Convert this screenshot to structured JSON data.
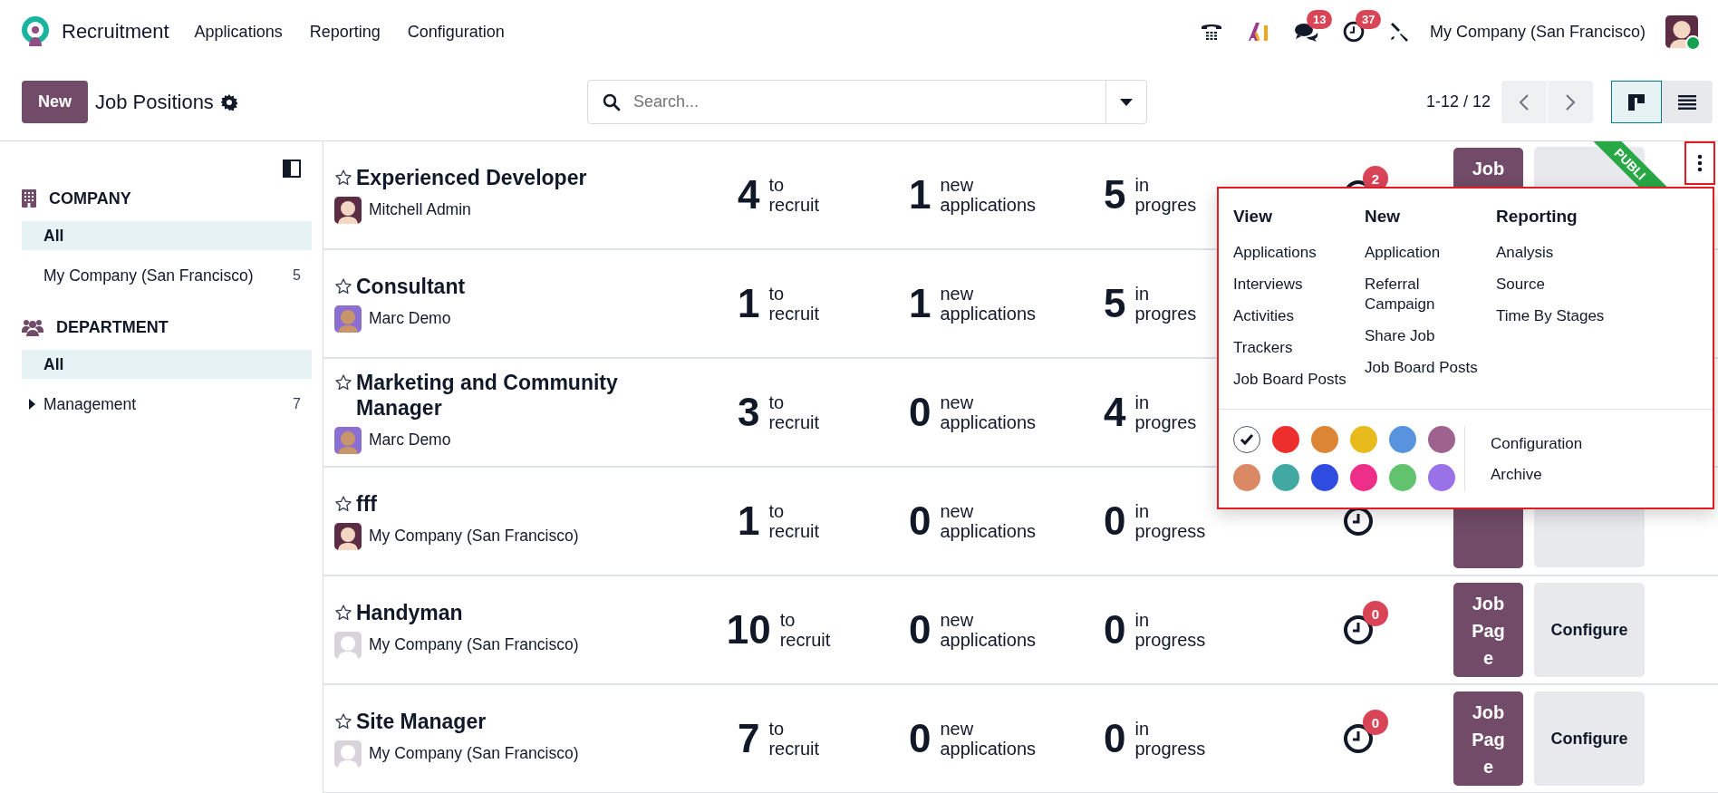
{
  "navbar": {
    "app": "Recruitment",
    "menu": [
      "Applications",
      "Reporting",
      "Configuration"
    ],
    "systray": [
      {
        "kind": "phone"
      },
      {
        "kind": "ai"
      },
      {
        "kind": "chat",
        "badge": "13"
      },
      {
        "kind": "activity",
        "badge": "37"
      },
      {
        "kind": "tools"
      }
    ],
    "company": "My Company (San Francisco)",
    "user_online": true
  },
  "control_panel": {
    "new_button": "New",
    "title": "Job Positions",
    "search": {
      "placeholder": "Search..."
    },
    "pager": "1-12 / 12",
    "views": [
      {
        "kind": "kanban",
        "selected": true
      },
      {
        "kind": "list",
        "selected": false
      }
    ]
  },
  "sidebar": {
    "sections": [
      {
        "kind": "company",
        "title": "COMPANY",
        "items": [
          {
            "label": "All",
            "selected": true
          },
          {
            "label": "My Company (San Francisco)",
            "count": "5",
            "selected": false
          }
        ]
      },
      {
        "kind": "department",
        "title": "DEPARTMENT",
        "items": [
          {
            "label": "All",
            "selected": true
          },
          {
            "label": "Management",
            "count": "7",
            "selected": false,
            "expanded": false
          }
        ]
      }
    ]
  },
  "rows": [
    {
      "title": "Experienced Developer",
      "favorite": false,
      "avatar": {
        "kind": "admin"
      },
      "subtitle": "Mitchell Admin",
      "stats": [
        {
          "value": "4",
          "label": "to recruit"
        },
        {
          "value": "1",
          "label": "new applications"
        },
        {
          "value": "5",
          "label": "in progres"
        }
      ],
      "activity": {
        "count": "2"
      },
      "job_page": {
        "label": "Job"
      },
      "configure": {},
      "ribbon": "PUBLI",
      "menu_open": true
    },
    {
      "title": "Consultant",
      "favorite": false,
      "avatar": {
        "kind": "demo"
      },
      "subtitle": "Marc Demo",
      "stats": [
        {
          "value": "1",
          "label": "to recruit"
        },
        {
          "value": "1",
          "label": "new applications"
        },
        {
          "value": "5",
          "label": "in progres"
        }
      ]
    },
    {
      "title": "Marketing and Community Manager",
      "favorite": false,
      "avatar": {
        "kind": "demo"
      },
      "subtitle": "Marc Demo",
      "stats": [
        {
          "value": "3",
          "label": "to recruit"
        },
        {
          "value": "0",
          "label": "new applications"
        },
        {
          "value": "4",
          "label": "in progres"
        }
      ]
    },
    {
      "title": "fff",
      "favorite": false,
      "avatar": {
        "kind": "admin"
      },
      "subtitle": "My Company (San Francisco)",
      "stats": [
        {
          "value": "1",
          "label": "to recruit"
        },
        {
          "value": "0",
          "label": "new applications"
        },
        {
          "value": "0",
          "label": "in progress"
        }
      ],
      "activity": {},
      "job_page": {},
      "configure": {}
    },
    {
      "title": "Handyman",
      "favorite": false,
      "avatar": {
        "kind": "bot"
      },
      "subtitle": "My Company (San Francisco)",
      "stats": [
        {
          "value": "10",
          "label": "to recruit"
        },
        {
          "value": "0",
          "label": "new applications"
        },
        {
          "value": "0",
          "label": "in progress"
        }
      ],
      "activity": {
        "count": "0"
      },
      "job_page": {
        "label": "Job Page"
      },
      "configure": {
        "label": "Configure"
      }
    },
    {
      "title": "Site Manager",
      "favorite": false,
      "avatar": {
        "kind": "bot"
      },
      "subtitle": "My Company (San Francisco)",
      "stats": [
        {
          "value": "7",
          "label": "to recruit"
        },
        {
          "value": "0",
          "label": "new applications"
        },
        {
          "value": "0",
          "label": "in progress"
        }
      ],
      "activity": {
        "count": "0"
      },
      "job_page": {
        "label": "Job Page"
      },
      "configure": {
        "label": "Configure"
      }
    }
  ],
  "card_menu": {
    "columns": [
      {
        "title": "View",
        "items": [
          "Applications",
          "Interviews",
          "Activities",
          "Trackers",
          "Job Board Posts"
        ]
      },
      {
        "title": "New",
        "items": [
          "Application",
          "Referral Campaign",
          "Share Job",
          "Job Board Posts"
        ]
      },
      {
        "title": "Reporting",
        "items": [
          "Analysis",
          "Source",
          "Time By Stages"
        ]
      }
    ],
    "colors": [
      {
        "kind": "none",
        "selected": true
      },
      {
        "kind": "color",
        "color": "#ee2d2d",
        "selected": false
      },
      {
        "kind": "color",
        "color": "#dc8534",
        "selected": false
      },
      {
        "kind": "color",
        "color": "#e8bb1d",
        "selected": false
      },
      {
        "kind": "color",
        "color": "#5794dd",
        "selected": false
      },
      {
        "kind": "color",
        "color": "#9f628f",
        "selected": false
      },
      {
        "kind": "color",
        "color": "#db8865",
        "selected": false
      },
      {
        "kind": "color",
        "color": "#41a9a2",
        "selected": false
      },
      {
        "kind": "color",
        "color": "#304be0",
        "selected": false
      },
      {
        "kind": "color",
        "color": "#ee2f8a",
        "selected": false
      },
      {
        "kind": "color",
        "color": "#61c36e",
        "selected": false
      },
      {
        "kind": "color",
        "color": "#9872e6",
        "selected": false
      }
    ],
    "actions": [
      "Configuration",
      "Archive"
    ]
  }
}
